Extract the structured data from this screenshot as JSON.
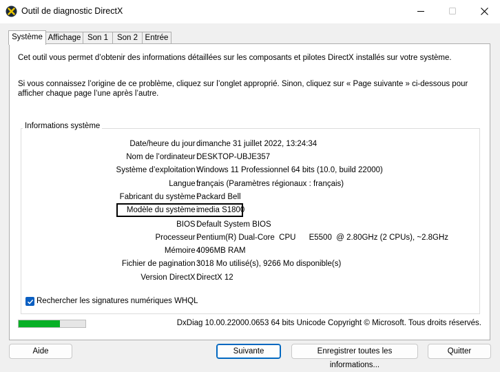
{
  "window": {
    "title": "Outil de diagnostic DirectX",
    "icon": "directx-x-icon"
  },
  "tabs": [
    {
      "label": "Système",
      "active": true
    },
    {
      "label": "Affichage",
      "active": false
    },
    {
      "label": "Son 1",
      "active": false
    },
    {
      "label": "Son 2",
      "active": false
    },
    {
      "label": "Entrée",
      "active": false
    }
  ],
  "intro": {
    "line1": "Cet outil vous permet d’obtenir des informations détaillées sur les composants et pilotes DirectX installés sur votre système.",
    "line2": "Si vous connaissez l’origine de ce problème, cliquez sur l’onglet approprié. Sinon, cliquez sur « Page suivante » ci-dessous pour afficher chaque page l’une après l’autre."
  },
  "system_info": {
    "title": "Informations système",
    "rows": [
      {
        "label": "Date/heure du jour :",
        "value": "dimanche 31 juillet 2022, 13:24:34"
      },
      {
        "label": "Nom de l’ordinateur :",
        "value": "DESKTOP-UBJE357"
      },
      {
        "label": "Système d’exploitation :",
        "value": "Windows 11 Professionnel 64 bits (10.0, build 22000)"
      },
      {
        "label": "Langue :",
        "value": "français (Paramètres régionaux : français)"
      },
      {
        "label": "Fabricant du système :",
        "value": "Packard Bell"
      },
      {
        "label": "Modèle du système :",
        "value": "imedia S1800"
      },
      {
        "label": "BIOS :",
        "value": "Default System BIOS"
      },
      {
        "label": "Processeur :",
        "value": "Pentium(R) Dual-Core  CPU      E5500  @ 2.80GHz (2 CPUs), ~2.8GHz"
      },
      {
        "label": "Mémoire :",
        "value": "4096MB RAM"
      },
      {
        "label": "Fichier de pagination :",
        "value": "3018 Mo utilisé(s), 9266 Mo disponible(s)"
      },
      {
        "label": "Version DirectX :",
        "value": "DirectX 12"
      }
    ]
  },
  "whql_checkbox": {
    "label": "Rechercher les signatures numériques WHQL",
    "checked": true
  },
  "progress": {
    "fraction": 0.62,
    "color": "#06b025"
  },
  "footer": {
    "version_text": "DxDiag 10.00.22000.0653 64 bits Unicode Copyright © Microsoft. Tous droits réservés."
  },
  "buttons": {
    "help": "Aide",
    "next": "Suivante",
    "save_all": "Enregistrer toutes les informations...",
    "quit": "Quitter"
  },
  "colors": {
    "accent": "#0067c0",
    "checkbox": "#0a5fc2"
  }
}
